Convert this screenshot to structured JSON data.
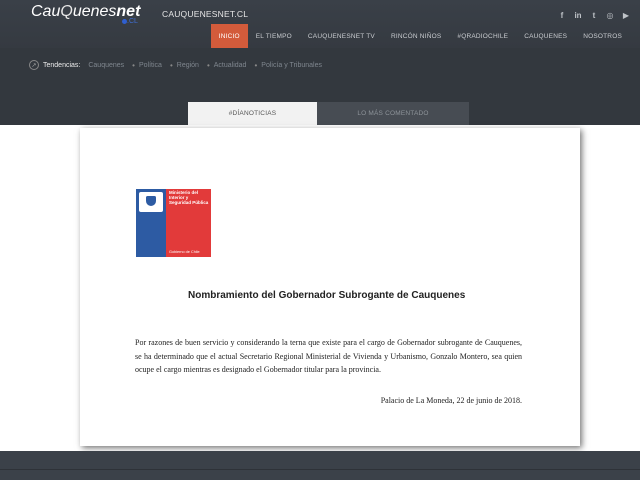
{
  "header": {
    "logo": {
      "part1": "Cau",
      "part2": "Q",
      "part3": "uenes",
      "part4": "net",
      "suffix": ".CL"
    },
    "site_name": "CAUQUENESNET.CL",
    "social": [
      {
        "name": "facebook",
        "glyph": "f"
      },
      {
        "name": "linkedin",
        "glyph": "in"
      },
      {
        "name": "twitter",
        "glyph": "t"
      },
      {
        "name": "instagram",
        "glyph": "◎"
      },
      {
        "name": "youtube",
        "glyph": "▶"
      }
    ],
    "nav": [
      "INICIO",
      "EL TIEMPO",
      "CAUQUENESNET TV",
      "RINCÓN NIÑOS",
      "#QRADIOCHILE",
      "CAUQUENES",
      "NOSOTROS"
    ],
    "accent_color": "#d35b3b"
  },
  "trends": {
    "label": "Tendencias:",
    "items": [
      "Cauquenes",
      "Política",
      "Región",
      "Actualidad",
      "Policía y Tribunales"
    ]
  },
  "tabs": [
    "#DÍANOTICIAS",
    "LO MÁS COMENTADO"
  ],
  "document": {
    "ministry_text": "Ministerio del Interior y Seguridad Pública",
    "government_text": "Gobierno de Chile",
    "title": "Nombramiento del Gobernador Subrogante de Cauquenes",
    "body": "Por razones de buen servicio y considerando la terna que existe para el cargo de Gobernador subrogante de Cauquenes, se ha determinado que el actual Secretario Regional Ministerial de Vivienda y Urbanismo, Gonzalo Montero, sea quien ocupe el cargo mientras es designado el Gobernador titular para la provincia.",
    "signature": "Palacio de La Moneda, 22 de junio de 2018."
  }
}
